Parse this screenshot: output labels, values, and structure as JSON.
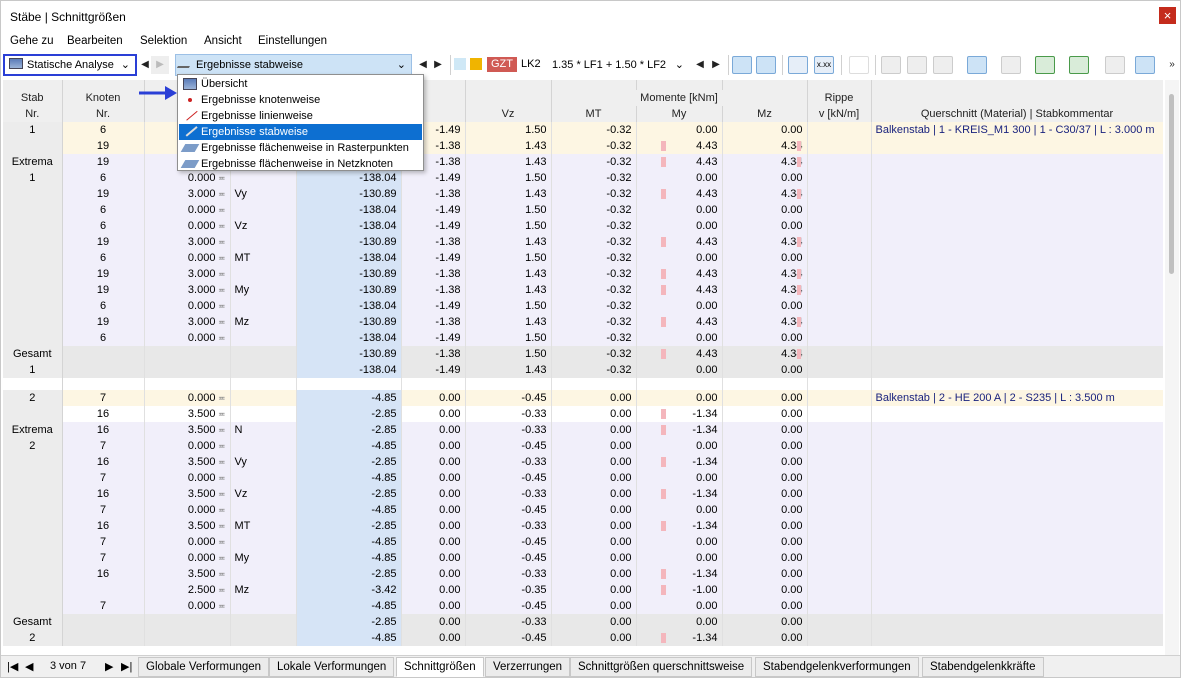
{
  "window": {
    "title": "Stäbe | Schnittgrößen",
    "close": "×"
  },
  "menu": [
    "Gehe zu",
    "Bearbeiten",
    "Selektion",
    "Ansicht",
    "Einstellungen"
  ],
  "toolbar": {
    "analysis": "Statische Analyse",
    "results_mode": "Ergebnisse stabweise",
    "gzt": "GZT",
    "lk": "LK2",
    "combo": "1.35 * LF1 + 1.50 * LF2",
    "accent": "#2a3fd6",
    "gzt_color": "#d05a54"
  },
  "dropdown": {
    "items": [
      "Übersicht",
      "Ergebnisse knotenweise",
      "Ergebnisse linienweise",
      "Ergebnisse stabweise",
      "Ergebnisse flächenweise in Rasterpunkten",
      "Ergebnisse flächenweise in Netzknoten"
    ],
    "selected": "Ergebnisse stabweise"
  },
  "headers": {
    "stab": "Stab",
    "stab_nr": "Nr.",
    "knoten": "Knoten",
    "knoten_nr": "Nr.",
    "kraefte": "e [kN]",
    "vy": "Vy",
    "vz": "Vz",
    "momente": "Momente [kNm]",
    "mt": "MT",
    "my": "My",
    "mz": "Mz",
    "rippe": "Rippe",
    "rippe_unit": "v [kN/m]",
    "querschnitt": "Querschnitt (Material) | Stabkommentar"
  },
  "rows": [
    {
      "t": "hl",
      "s": "1",
      "k": "6",
      "x": "",
      "typ": "",
      "n": "",
      "vy": "-1.49",
      "vz": "1.50",
      "mt": "-0.32",
      "my": "0.00",
      "mz": "0.00",
      "qs": "Balkenstab | 1 - KREIS_M1 300 | 1 - C30/37 | L : 3.000 m"
    },
    {
      "t": "hl",
      "s": "",
      "k": "19",
      "x": "",
      "typ": "",
      "n": "",
      "vy": "-1.38",
      "vz": "1.43",
      "mt": "-0.32",
      "my": "4.43",
      "mz": "4.34",
      "qs": ""
    },
    {
      "t": "alt",
      "s": "Extrema",
      "k": "19",
      "x": "",
      "typ": "",
      "n": "",
      "vy": "-1.38",
      "vz": "1.43",
      "mt": "-0.32",
      "my": "4.43",
      "mz": "4.34",
      "qs": ""
    },
    {
      "t": "alt",
      "s": "1",
      "k": "6",
      "x": "0.000",
      "typ": "",
      "n": "-138.04",
      "vy": "-1.49",
      "vz": "1.50",
      "mt": "-0.32",
      "my": "0.00",
      "mz": "0.00",
      "qs": ""
    },
    {
      "t": "alt",
      "s": "",
      "k": "19",
      "x": "3.000",
      "typ": "Vy",
      "n": "-130.89",
      "vy": "-1.38",
      "vz": "1.43",
      "mt": "-0.32",
      "my": "4.43",
      "mz": "4.34",
      "qs": ""
    },
    {
      "t": "alt",
      "s": "",
      "k": "6",
      "x": "0.000",
      "typ": "",
      "n": "-138.04",
      "vy": "-1.49",
      "vz": "1.50",
      "mt": "-0.32",
      "my": "0.00",
      "mz": "0.00",
      "qs": ""
    },
    {
      "t": "alt",
      "s": "",
      "k": "6",
      "x": "0.000",
      "typ": "Vz",
      "n": "-138.04",
      "vy": "-1.49",
      "vz": "1.50",
      "mt": "-0.32",
      "my": "0.00",
      "mz": "0.00",
      "qs": ""
    },
    {
      "t": "alt",
      "s": "",
      "k": "19",
      "x": "3.000",
      "typ": "",
      "n": "-130.89",
      "vy": "-1.38",
      "vz": "1.43",
      "mt": "-0.32",
      "my": "4.43",
      "mz": "4.34",
      "qs": ""
    },
    {
      "t": "alt",
      "s": "",
      "k": "6",
      "x": "0.000",
      "typ": "MT",
      "n": "-138.04",
      "vy": "-1.49",
      "vz": "1.50",
      "mt": "-0.32",
      "my": "0.00",
      "mz": "0.00",
      "qs": ""
    },
    {
      "t": "alt",
      "s": "",
      "k": "19",
      "x": "3.000",
      "typ": "",
      "n": "-130.89",
      "vy": "-1.38",
      "vz": "1.43",
      "mt": "-0.32",
      "my": "4.43",
      "mz": "4.34",
      "qs": ""
    },
    {
      "t": "alt",
      "s": "",
      "k": "19",
      "x": "3.000",
      "typ": "My",
      "n": "-130.89",
      "vy": "-1.38",
      "vz": "1.43",
      "mt": "-0.32",
      "my": "4.43",
      "mz": "4.34",
      "qs": ""
    },
    {
      "t": "alt",
      "s": "",
      "k": "6",
      "x": "0.000",
      "typ": "",
      "n": "-138.04",
      "vy": "-1.49",
      "vz": "1.50",
      "mt": "-0.32",
      "my": "0.00",
      "mz": "0.00",
      "qs": ""
    },
    {
      "t": "alt",
      "s": "",
      "k": "19",
      "x": "3.000",
      "typ": "Mz",
      "n": "-130.89",
      "vy": "-1.38",
      "vz": "1.43",
      "mt": "-0.32",
      "my": "4.43",
      "mz": "4.34",
      "qs": ""
    },
    {
      "t": "alt",
      "s": "",
      "k": "6",
      "x": "0.000",
      "typ": "",
      "n": "-138.04",
      "vy": "-1.49",
      "vz": "1.50",
      "mt": "-0.32",
      "my": "0.00",
      "mz": "0.00",
      "qs": ""
    },
    {
      "t": "tot",
      "s": "Gesamt",
      "k": "",
      "x": "",
      "typ": "",
      "n": "-130.89",
      "vy": "-1.38",
      "vz": "1.50",
      "mt": "-0.32",
      "my": "4.43",
      "mz": "4.34",
      "qs": ""
    },
    {
      "t": "tot",
      "s": "1",
      "k": "",
      "x": "",
      "typ": "",
      "n": "-138.04",
      "vy": "-1.49",
      "vz": "1.43",
      "mt": "-0.32",
      "my": "0.00",
      "mz": "0.00",
      "qs": ""
    },
    {
      "t": "gap",
      "s": "",
      "k": "",
      "x": "",
      "typ": "",
      "n": "",
      "vy": "",
      "vz": "",
      "mt": "",
      "my": "",
      "mz": "",
      "qs": ""
    },
    {
      "t": "hl",
      "s": "2",
      "k": "7",
      "x": "0.000",
      "typ": "",
      "n": "-4.85",
      "vy": "0.00",
      "vz": "-0.45",
      "mt": "0.00",
      "my": "0.00",
      "mz": "0.00",
      "qs": "Balkenstab | 2 - HE 200 A | 2 - S235 | L : 3.500 m"
    },
    {
      "t": "pl",
      "s": "",
      "k": "16",
      "x": "3.500",
      "typ": "",
      "n": "-2.85",
      "vy": "0.00",
      "vz": "-0.33",
      "mt": "0.00",
      "my": "-1.34",
      "mz": "0.00",
      "qs": ""
    },
    {
      "t": "alt",
      "s": "Extrema",
      "k": "16",
      "x": "3.500",
      "typ": "N",
      "n": "-2.85",
      "vy": "0.00",
      "vz": "-0.33",
      "mt": "0.00",
      "my": "-1.34",
      "mz": "0.00",
      "qs": ""
    },
    {
      "t": "alt",
      "s": "2",
      "k": "7",
      "x": "0.000",
      "typ": "",
      "n": "-4.85",
      "vy": "0.00",
      "vz": "-0.45",
      "mt": "0.00",
      "my": "0.00",
      "mz": "0.00",
      "qs": ""
    },
    {
      "t": "alt",
      "s": "",
      "k": "16",
      "x": "3.500",
      "typ": "Vy",
      "n": "-2.85",
      "vy": "0.00",
      "vz": "-0.33",
      "mt": "0.00",
      "my": "-1.34",
      "mz": "0.00",
      "qs": ""
    },
    {
      "t": "alt",
      "s": "",
      "k": "7",
      "x": "0.000",
      "typ": "",
      "n": "-4.85",
      "vy": "0.00",
      "vz": "-0.45",
      "mt": "0.00",
      "my": "0.00",
      "mz": "0.00",
      "qs": ""
    },
    {
      "t": "alt",
      "s": "",
      "k": "16",
      "x": "3.500",
      "typ": "Vz",
      "n": "-2.85",
      "vy": "0.00",
      "vz": "-0.33",
      "mt": "0.00",
      "my": "-1.34",
      "mz": "0.00",
      "qs": ""
    },
    {
      "t": "alt",
      "s": "",
      "k": "7",
      "x": "0.000",
      "typ": "",
      "n": "-4.85",
      "vy": "0.00",
      "vz": "-0.45",
      "mt": "0.00",
      "my": "0.00",
      "mz": "0.00",
      "qs": ""
    },
    {
      "t": "alt",
      "s": "",
      "k": "16",
      "x": "3.500",
      "typ": "MT",
      "n": "-2.85",
      "vy": "0.00",
      "vz": "-0.33",
      "mt": "0.00",
      "my": "-1.34",
      "mz": "0.00",
      "qs": ""
    },
    {
      "t": "alt",
      "s": "",
      "k": "7",
      "x": "0.000",
      "typ": "",
      "n": "-4.85",
      "vy": "0.00",
      "vz": "-0.45",
      "mt": "0.00",
      "my": "0.00",
      "mz": "0.00",
      "qs": ""
    },
    {
      "t": "alt",
      "s": "",
      "k": "7",
      "x": "0.000",
      "typ": "My",
      "n": "-4.85",
      "vy": "0.00",
      "vz": "-0.45",
      "mt": "0.00",
      "my": "0.00",
      "mz": "0.00",
      "qs": ""
    },
    {
      "t": "alt",
      "s": "",
      "k": "16",
      "x": "3.500",
      "typ": "",
      "n": "-2.85",
      "vy": "0.00",
      "vz": "-0.33",
      "mt": "0.00",
      "my": "-1.34",
      "mz": "0.00",
      "qs": ""
    },
    {
      "t": "alt",
      "s": "",
      "k": "",
      "x": "2.500",
      "typ": "Mz",
      "n": "-3.42",
      "vy": "0.00",
      "vz": "-0.35",
      "mt": "0.00",
      "my": "-1.00",
      "mz": "0.00",
      "qs": ""
    },
    {
      "t": "alt",
      "s": "",
      "k": "7",
      "x": "0.000",
      "typ": "",
      "n": "-4.85",
      "vy": "0.00",
      "vz": "-0.45",
      "mt": "0.00",
      "my": "0.00",
      "mz": "0.00",
      "qs": ""
    },
    {
      "t": "tot",
      "s": "Gesamt",
      "k": "",
      "x": "",
      "typ": "",
      "n": "-2.85",
      "vy": "0.00",
      "vz": "-0.33",
      "mt": "0.00",
      "my": "0.00",
      "mz": "0.00",
      "qs": ""
    },
    {
      "t": "tot",
      "s": "2",
      "k": "",
      "x": "",
      "typ": "",
      "n": "-4.85",
      "vy": "0.00",
      "vz": "-0.45",
      "mt": "0.00",
      "my": "-1.34",
      "mz": "0.00",
      "qs": ""
    }
  ],
  "bottom": {
    "page": "3 von 7",
    "tabs": [
      "Globale Verformungen",
      "Lokale Verformungen",
      "Schnittgrößen",
      "Verzerrungen",
      "Schnittgrößen querschnittsweise",
      "Stabendgelenkverformungen",
      "Stabendgelenkkräfte"
    ],
    "active": "Schnittgrößen"
  }
}
